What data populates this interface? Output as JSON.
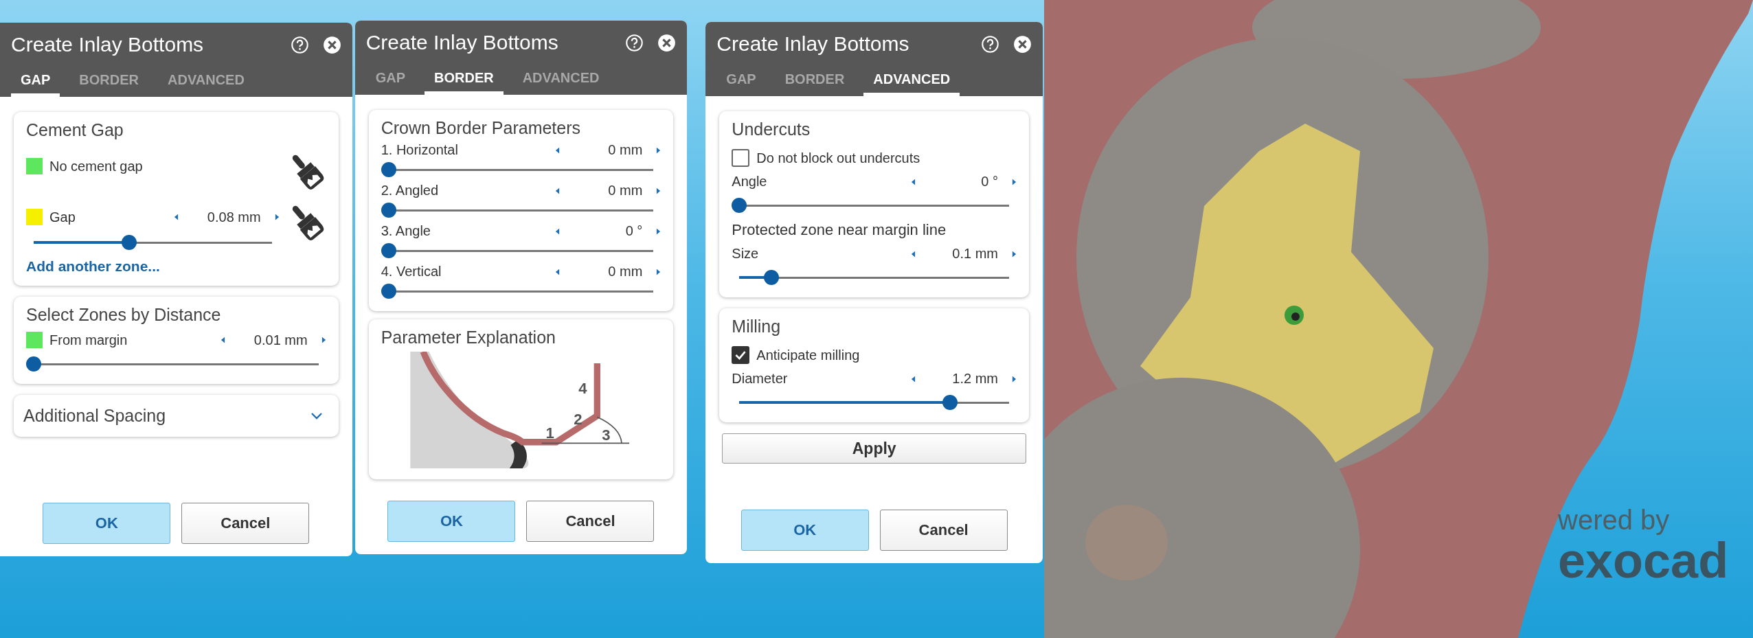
{
  "dialogs": [
    {
      "title": "Create Inlay Bottoms",
      "tabs": [
        {
          "label": "GAP",
          "selected": true
        },
        {
          "label": "BORDER",
          "selected": false
        },
        {
          "label": "ADVANCED",
          "selected": false
        }
      ],
      "sections": [
        {
          "title": "Cement Gap",
          "items": [
            {
              "kind": "swatch",
              "label": "No cement gap",
              "color": "#5ee65e"
            },
            {
              "kind": "swatch-slider",
              "label": "Gap",
              "color": "#f5f000",
              "value": "0.08 mm",
              "level": 0.4
            },
            {
              "kind": "link",
              "label": "Add another zone..."
            }
          ]
        },
        {
          "title": "Select Zones by Distance",
          "items": [
            {
              "kind": "swatch-slider-wide",
              "label": "From margin",
              "color": "#5ee65e",
              "value": "0.01 mm",
              "level": 0
            }
          ]
        },
        {
          "title": "Additional Spacing",
          "expanded": false
        }
      ],
      "buttons": [
        {
          "label": "OK",
          "kind": "primary"
        },
        {
          "label": "Cancel",
          "kind": "secondary"
        }
      ]
    },
    {
      "title": "Create Inlay Bottoms",
      "tabs": [
        {
          "label": "GAP",
          "selected": false
        },
        {
          "label": "BORDER",
          "selected": true
        },
        {
          "label": "ADVANCED",
          "selected": false
        }
      ],
      "sections": [
        {
          "title": "Crown Border Parameters",
          "items": [
            {
              "kind": "slider",
              "label": "1. Horizontal",
              "value": "0 mm",
              "level": 0
            },
            {
              "kind": "slider",
              "label": "2. Angled",
              "value": "0 mm",
              "level": 0
            },
            {
              "kind": "slider",
              "label": "3. Angle",
              "value": "0 °",
              "level": 0
            },
            {
              "kind": "slider",
              "label": "4. Vertical",
              "value": "0 mm",
              "level": 0
            }
          ]
        },
        {
          "title": "Parameter Explanation",
          "items": [
            {
              "kind": "diagram",
              "labels": [
                "1",
                "2",
                "3",
                "4"
              ]
            }
          ]
        }
      ],
      "buttons": [
        {
          "label": "OK",
          "kind": "primary"
        },
        {
          "label": "Cancel",
          "kind": "secondary"
        }
      ]
    },
    {
      "title": "Create Inlay Bottoms",
      "tabs": [
        {
          "label": "GAP",
          "selected": false
        },
        {
          "label": "BORDER",
          "selected": false
        },
        {
          "label": "ADVANCED",
          "selected": true
        }
      ],
      "sections": [
        {
          "title": "Undercuts",
          "items": [
            {
              "kind": "checkbox",
              "label": "Do not block out undercuts",
              "checked": false
            },
            {
              "kind": "slider",
              "label": "Angle",
              "value": "0 °",
              "level": 0
            },
            {
              "kind": "subheading",
              "label": "Protected zone near margin line"
            },
            {
              "kind": "slider",
              "label": "Size",
              "value": "0.1 mm",
              "level": 0.12
            }
          ]
        },
        {
          "title": "Milling",
          "items": [
            {
              "kind": "checkbox",
              "label": "Anticipate milling",
              "checked": true
            },
            {
              "kind": "slider",
              "label": "Diameter",
              "value": "1.2 mm",
              "level": 0.78
            }
          ]
        }
      ],
      "action": "Apply",
      "buttons": [
        {
          "label": "OK",
          "kind": "primary"
        },
        {
          "label": "Cancel",
          "kind": "secondary"
        }
      ]
    }
  ],
  "branding": {
    "line_1": "wered by",
    "line_2": "exocad"
  }
}
